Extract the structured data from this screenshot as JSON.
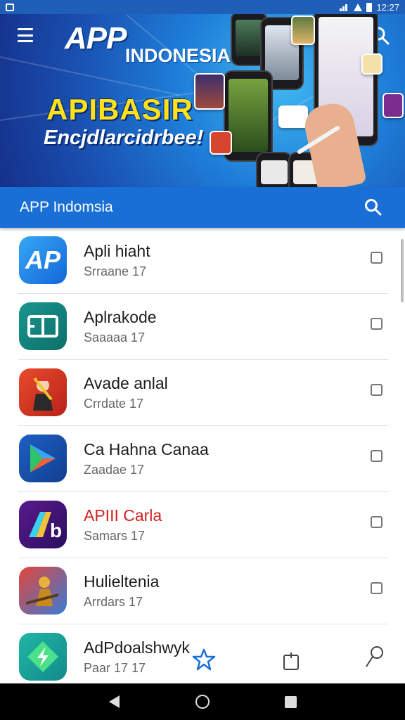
{
  "status_bar": {
    "time": "12:27"
  },
  "banner": {
    "logo_app": "APP",
    "logo_indonesia": "INDONESIA",
    "title": "APIBASIR",
    "subtitle": "Encjdlarcidrbee!"
  },
  "app_bar": {
    "title": "APP Indomsia"
  },
  "apps": [
    {
      "name": "Apli hiaht",
      "sub": "Srraane 17"
    },
    {
      "name": "Aplrakode",
      "sub": "Saaaaa 17"
    },
    {
      "name": "Avade anlal",
      "sub": "Crrdate 17"
    },
    {
      "name": "Ca Hahna Canaa",
      "sub": "Zaadae 17"
    },
    {
      "name": "APIII Carla",
      "sub": "Samars 17"
    },
    {
      "name": "Hulieltenia",
      "sub": "Arrdars 17"
    },
    {
      "name": "AdPdoalshwyk",
      "sub": "Paar 17 17"
    }
  ],
  "icons": {
    "app1": "ap-logo-icon",
    "app2": "code-window-icon",
    "app3": "warrior-icon",
    "app4": "play-triangle-icon",
    "app5": "ab-letter-icon",
    "app6": "golden-figure-icon",
    "app7": "arrow-diamond-icon",
    "fab1": "star-icon",
    "fab2": "bag-icon",
    "fab3": "pin-icon"
  },
  "colors": {
    "accent": "#1a6fd6",
    "title_yellow": "#ffe21a",
    "app5_title": "#d32020"
  }
}
